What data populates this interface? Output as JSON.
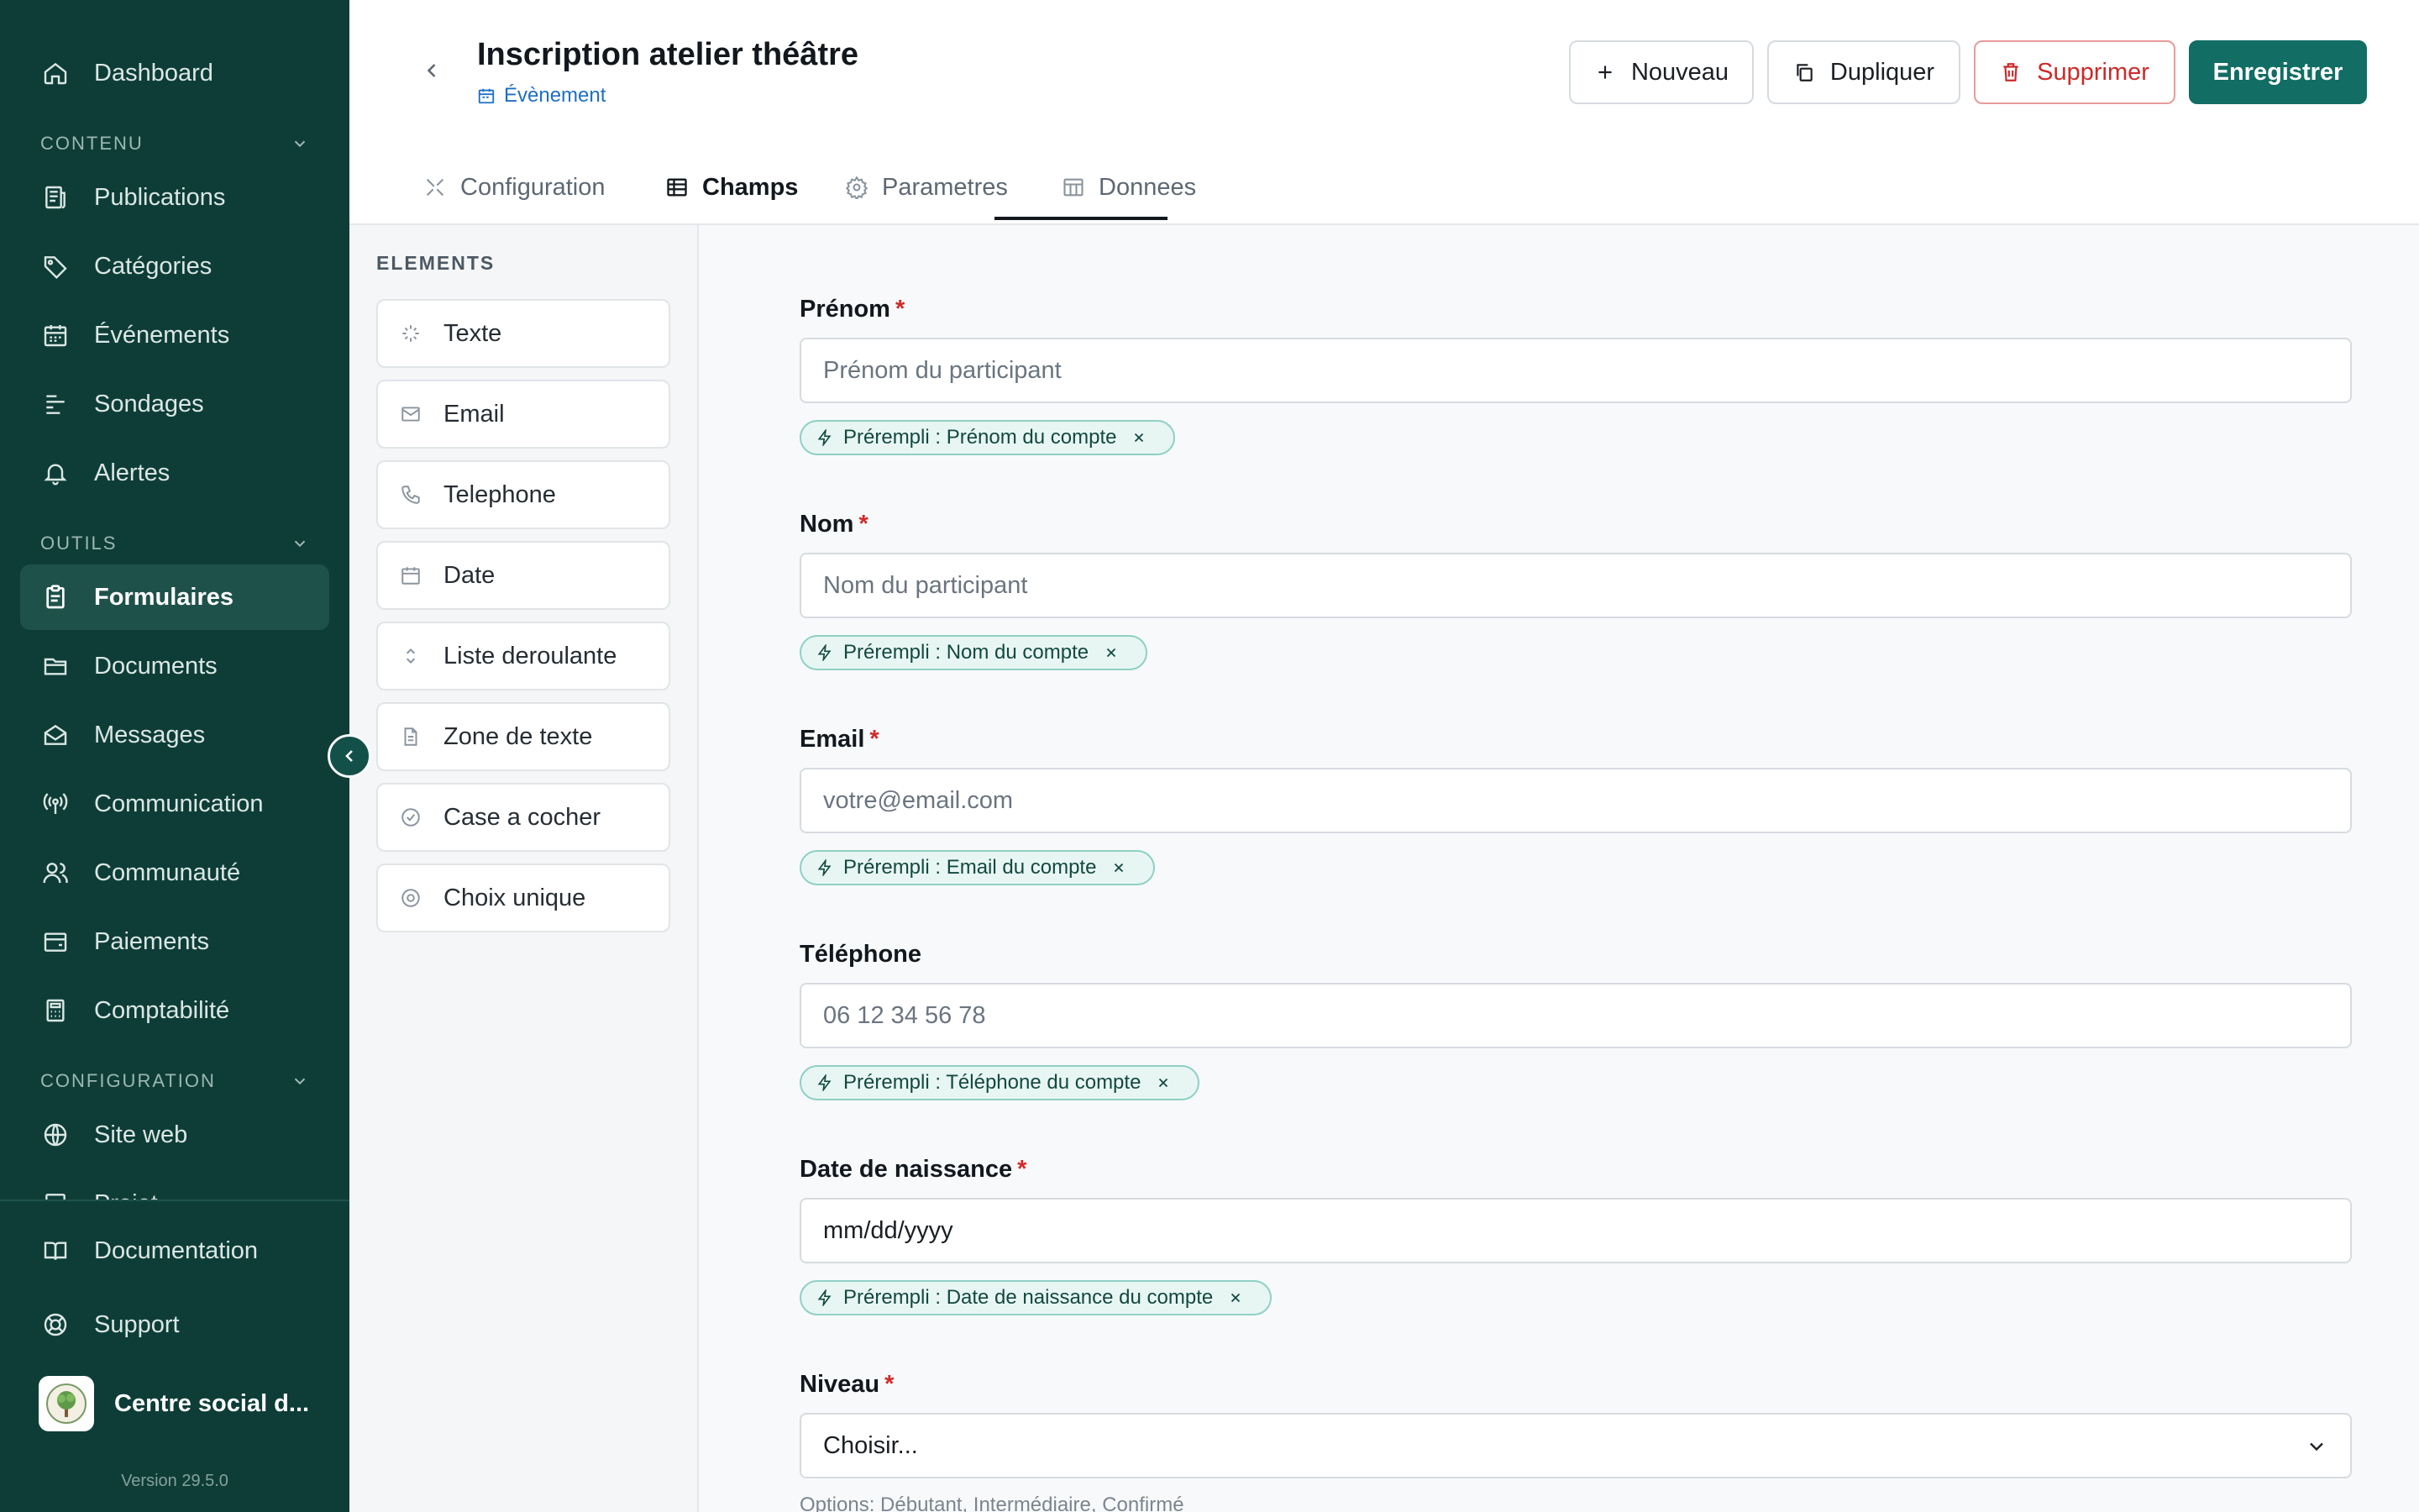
{
  "sidebar": {
    "items": [
      {
        "label": "Dashboard",
        "icon": "home-icon"
      },
      {
        "label": "Publications",
        "icon": "newspaper-icon"
      },
      {
        "label": "Catégories",
        "icon": "tag-icon"
      },
      {
        "label": "Événements",
        "icon": "calendar-icon"
      },
      {
        "label": "Sondages",
        "icon": "poll-icon"
      },
      {
        "label": "Alertes",
        "icon": "bell-icon"
      },
      {
        "label": "Formulaires",
        "icon": "clipboard-icon"
      },
      {
        "label": "Documents",
        "icon": "folder-icon"
      },
      {
        "label": "Messages",
        "icon": "mail-open-icon"
      },
      {
        "label": "Communication",
        "icon": "broadcast-icon"
      },
      {
        "label": "Communauté",
        "icon": "users-icon"
      },
      {
        "label": "Paiements",
        "icon": "wallet-icon"
      },
      {
        "label": "Comptabilité",
        "icon": "calculator-icon"
      },
      {
        "label": "Site web",
        "icon": "globe-icon"
      },
      {
        "label": "Projet",
        "icon": "project-icon"
      }
    ],
    "active": "Formulaires",
    "sections": {
      "contenu": "CONTENU",
      "outils": "OUTILS",
      "configuration": "CONFIGURATION"
    },
    "bottom": {
      "documentation": "Documentation",
      "support": "Support"
    },
    "org_name": "Centre social d...",
    "version": "Version 29.5.0"
  },
  "header": {
    "title": "Inscription atelier théâtre",
    "subtitle": "Évènement",
    "buttons": {
      "new": "Nouveau",
      "duplicate": "Dupliquer",
      "delete": "Supprimer",
      "save": "Enregistrer"
    }
  },
  "tabs": [
    {
      "label": "Configuration"
    },
    {
      "label": "Champs"
    },
    {
      "label": "Parametres"
    },
    {
      "label": "Donnees"
    }
  ],
  "active_tab": "Champs",
  "elements": {
    "title": "ELEMENTS",
    "items": [
      "Texte",
      "Email",
      "Telephone",
      "Date",
      "Liste deroulante",
      "Zone de texte",
      "Case a cocher",
      "Choix unique"
    ]
  },
  "form": {
    "fields": [
      {
        "label": "Prénom",
        "required": "*",
        "placeholder": "Prénom du participant",
        "chip": "Prérempli : Prénom du compte"
      },
      {
        "label": "Nom",
        "required": "*",
        "placeholder": "Nom du participant",
        "chip": "Prérempli : Nom du compte"
      },
      {
        "label": "Email",
        "required": "*",
        "placeholder": "votre@email.com",
        "chip": "Prérempli : Email du compte"
      },
      {
        "label": "Téléphone",
        "required": "",
        "placeholder": "06 12 34 56 78",
        "chip": "Prérempli : Téléphone du compte"
      },
      {
        "label": "Date de naissance",
        "required": "*",
        "placeholder": "mm/dd/yyyy",
        "chip": "Prérempli : Date de naissance du compte"
      },
      {
        "label": "Niveau",
        "required": "*",
        "placeholder": "Choisir...",
        "hint": "Options: Débutant, Intermédiaire, Confirmé"
      }
    ]
  },
  "colors": {
    "sidebar_bg": "#0e3d38",
    "primary": "#126d64",
    "danger": "#cc2a2a",
    "chip_bg": "#e8f6f3"
  }
}
